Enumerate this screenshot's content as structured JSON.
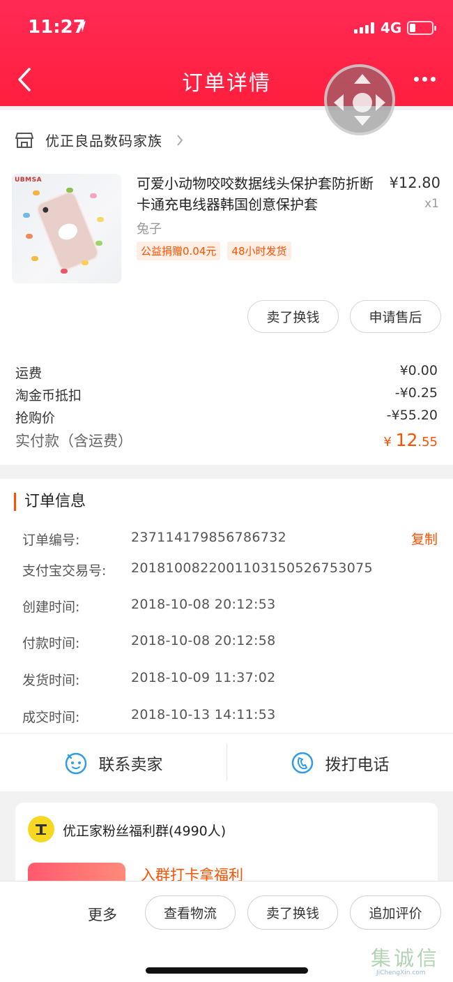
{
  "status_bar": {
    "time": "11:27",
    "network": "4G"
  },
  "nav": {
    "title": "订单详情"
  },
  "shop": {
    "name": "优正良品数码家族"
  },
  "product": {
    "image_brand": "UBMSA",
    "title": "可爱小动物咬咬数据线头保护套防折断卡通充电线器韩国创意保护套",
    "price": "¥12.80",
    "quantity": "x1",
    "sku": "兔子",
    "tags": [
      "公益捐赠0.04元",
      "48小时发货"
    ]
  },
  "item_actions": {
    "sell": "卖了换钱",
    "after_sale": "申请售后"
  },
  "fees": [
    {
      "label": "运费",
      "value": "¥0.00"
    },
    {
      "label": "淘金币抵扣",
      "value": "-¥0.25"
    },
    {
      "label": "抢购价",
      "value": "-¥55.20"
    }
  ],
  "total": {
    "label": "实付款（含运费）",
    "currency": "¥",
    "integer": "12",
    "decimal": ".55"
  },
  "order_info": {
    "title": "订单信息",
    "copy_label": "复制",
    "rows": [
      {
        "label": "订单编号:",
        "value": "237114179856786732"
      },
      {
        "label": "支付宝交易号:",
        "value": "2018100822001103150526753075"
      },
      {
        "label": "创建时间:",
        "value": "2018-10-08 20:12:53"
      },
      {
        "label": "付款时间:",
        "value": "2018-10-08 20:12:58"
      },
      {
        "label": "发货时间:",
        "value": "2018-10-09 11:37:02"
      },
      {
        "label": "成交时间:",
        "value": "2018-10-13 14:11:53"
      }
    ]
  },
  "contact": {
    "seller": "联系卖家",
    "phone": "拨打电话"
  },
  "group": {
    "name": "优正家粉丝福利群(4990人)",
    "cta": "入群打卡拿福利"
  },
  "bottom_bar": {
    "more": "更多",
    "logistics": "查看物流",
    "sell": "卖了换钱",
    "review": "追加评价"
  },
  "watermark": {
    "cn": "集诚信",
    "en": "JiChengXin.com"
  },
  "colors": {
    "brand_red": "#ff1f3e",
    "accent_orange": "#ff5000",
    "contact_blue": "#2f9be8"
  }
}
